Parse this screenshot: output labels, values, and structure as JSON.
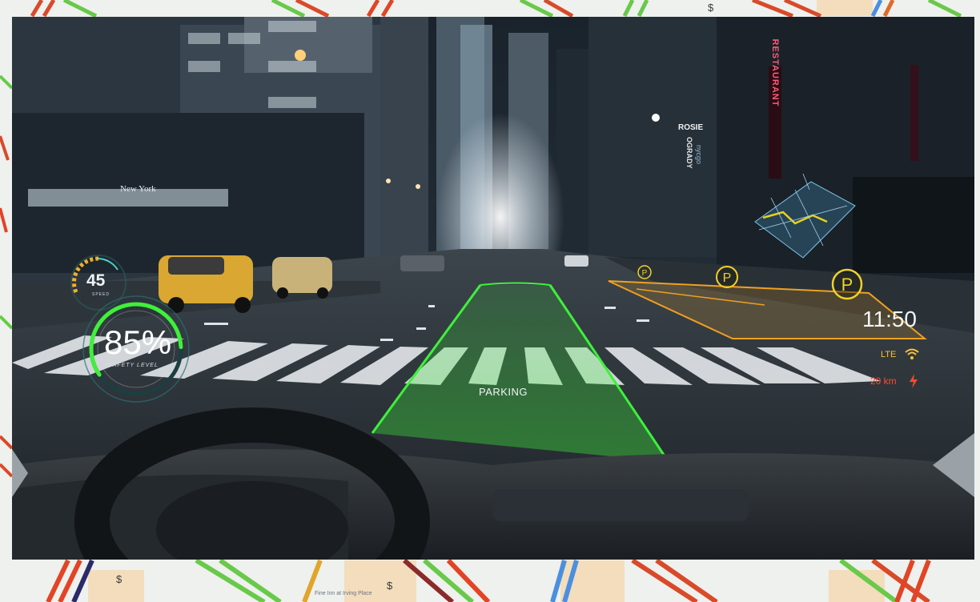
{
  "map": {
    "dollar_marker_1": "$",
    "dollar_marker_2": "$",
    "dollar_marker_3": "$",
    "place_label": "Fine Inn at Irving Place"
  },
  "hud": {
    "speed_value": "45",
    "speed_label": "SPEED",
    "safety_value": "85%",
    "safety_label": "SAFETY LEVEL",
    "safety_level": 0.85,
    "parking_label": "PARKING",
    "parking_icon_text": "P",
    "clock": "11:50",
    "network": "LTE",
    "distance": "20 km",
    "lane_color": "#3ef03a",
    "route_color": "#e8d11e",
    "accent_orange": "#f0a020"
  },
  "scene": {
    "sign_restaurant": "RESTAURANT",
    "sign_rosie": "ROSIE",
    "sign_ogrady": "OGRADY",
    "sign_nycgo": "nycgo",
    "sign_newyork": "New York"
  },
  "icons": [
    "wifi-icon",
    "bolt-icon",
    "parking-icon",
    "speed-gauge-icon",
    "safety-gauge-icon",
    "nav-map-icon"
  ]
}
